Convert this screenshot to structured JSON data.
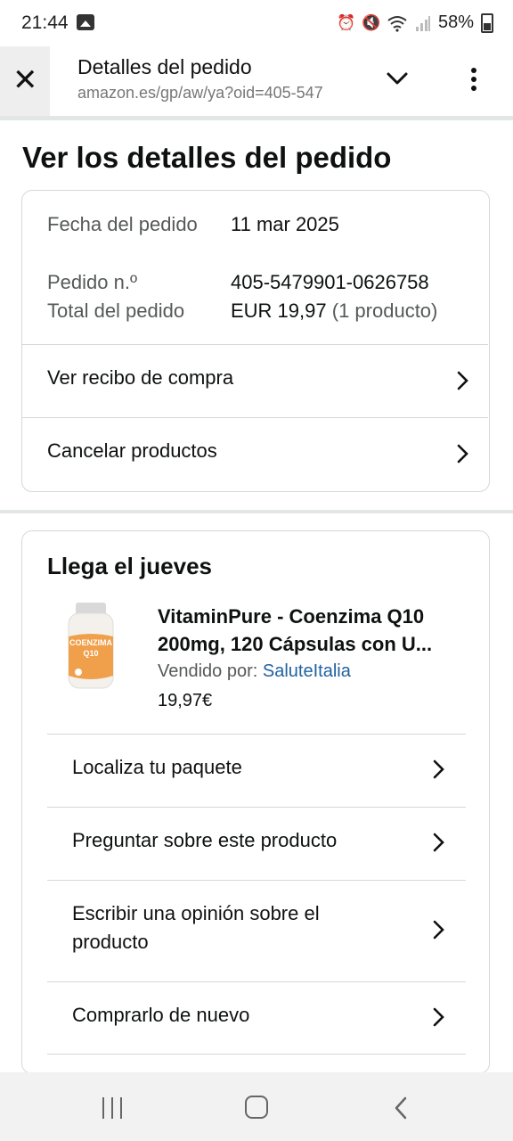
{
  "status_bar": {
    "time": "21:44",
    "battery": "58%",
    "icons": [
      "gallery-icon",
      "alarm-icon",
      "mute-icon",
      "wifi-icon",
      "signal-icon",
      "battery-icon"
    ]
  },
  "browser": {
    "page_title": "Detalles del pedido",
    "url": "amazon.es/gp/aw/ya?oid=405-547"
  },
  "page": {
    "heading": "Ver los detalles del pedido"
  },
  "order": {
    "date_label": "Fecha del pedido",
    "date_value": "11 mar 2025",
    "number_label": "Pedido n.º",
    "number_value": "405-5479901-0626758",
    "total_label": "Total del pedido",
    "total_value": "EUR 19,97",
    "total_count": "(1 producto)",
    "actions": [
      {
        "label": "Ver recibo de compra"
      },
      {
        "label": "Cancelar productos"
      }
    ]
  },
  "shipment": {
    "heading": "Llega el jueves",
    "product": {
      "title": "VitaminPure - Coenzima Q10 200mg, 120 Cápsulas con U...",
      "sold_by_label": "Vendido por:",
      "seller": "SaluteItalia",
      "price": "19,97€",
      "image_text_1": "COENZIMA",
      "image_text_2": "Q10"
    },
    "actions": [
      {
        "label": "Localiza tu paquete"
      },
      {
        "label": "Preguntar sobre este producto"
      },
      {
        "label": "Escribir una opinión sobre el producto"
      },
      {
        "label": "Comprarlo de nuevo"
      }
    ]
  },
  "colors": {
    "link": "#2162a1",
    "secondary_text": "#565959",
    "border": "#d5d9d9"
  }
}
